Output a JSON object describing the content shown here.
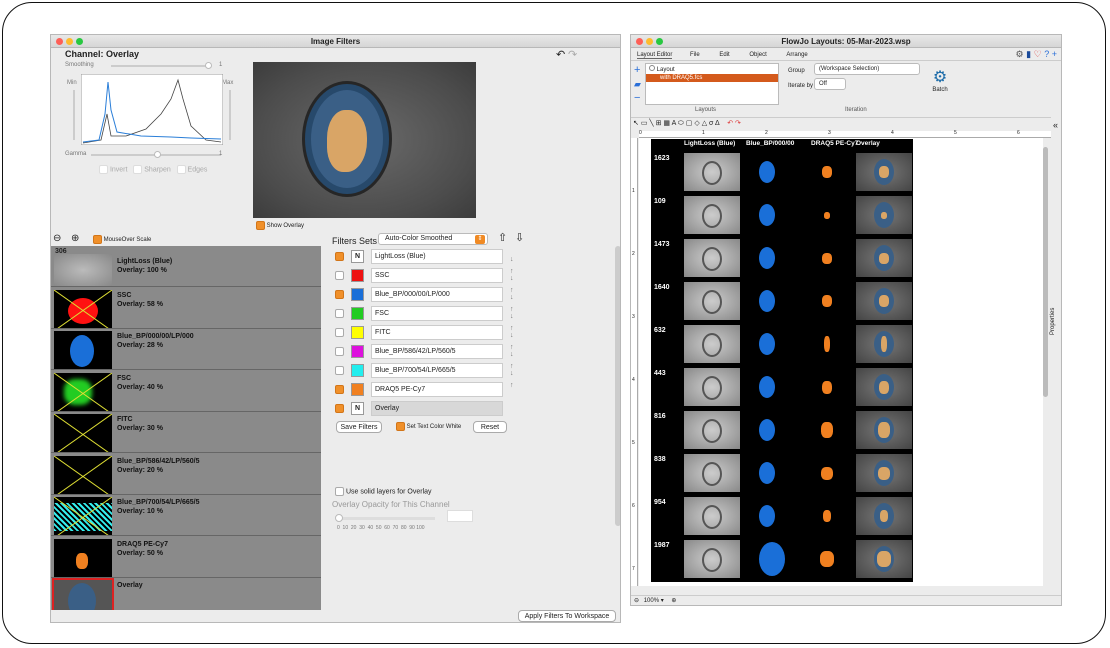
{
  "left_window": {
    "title": "Image Filters",
    "channel_title": "Channel: Overlay",
    "labels": {
      "smoothing": "Smoothing",
      "min": "Min",
      "max": "Max",
      "gamma": "Gamma",
      "one": "1",
      "invert": "Invert",
      "sharpen": "Sharpen",
      "edges": "Edges",
      "show_overlay": "Show Overlay",
      "mouseover_scale": "MouseOver Scale",
      "filters_sets": "Filters Sets",
      "filter_set_value": "Auto-Color Smoothed",
      "save_filters": "Save Filters",
      "set_text_color": "Set Text Color White",
      "reset": "Reset",
      "solid_layers": "Use solid layers for Overlay",
      "opacity_title": "Overlay Opacity for This Channel",
      "opacity_ticks": "0  10  20  30  40  50  60  70  80  90 100",
      "apply": "Apply Filters To Workspace"
    },
    "event_id": "306",
    "channels": [
      {
        "name": "LightLoss (Blue)",
        "overlay": "Overlay: 100 %",
        "kind": "gray",
        "crossed": false
      },
      {
        "name": "SSC",
        "overlay": "Overlay: 58 %",
        "kind": "red",
        "crossed": true
      },
      {
        "name": "Blue_BP/000/00/LP/000",
        "overlay": "Overlay: 28 %",
        "kind": "blue",
        "crossed": false
      },
      {
        "name": "FSC",
        "overlay": "Overlay: 40 %",
        "kind": "green",
        "crossed": true
      },
      {
        "name": "FITC",
        "overlay": "Overlay: 30 %",
        "kind": "black",
        "crossed": true
      },
      {
        "name": "Blue_BP/586/42/LP/560/5",
        "overlay": "Overlay: 20 %",
        "kind": "black",
        "crossed": true
      },
      {
        "name": "Blue_BP/700/54/LP/665/5",
        "overlay": "Overlay: 10 %",
        "kind": "cyan",
        "crossed": true
      },
      {
        "name": "DRAQ5 PE-Cy7",
        "overlay": "Overlay: 50 %",
        "kind": "orange",
        "crossed": false
      },
      {
        "name": "Overlay",
        "overlay": "",
        "kind": "overlay",
        "crossed": false
      }
    ],
    "filters": [
      {
        "name": "LightLoss (Blue)",
        "checked": true,
        "color": "#ffffff",
        "swatch": "N"
      },
      {
        "name": "SSC",
        "checked": false,
        "color": "#ee1111",
        "swatch": ""
      },
      {
        "name": "Blue_BP/000/00/LP/000",
        "checked": true,
        "color": "#1a6fd8",
        "swatch": ""
      },
      {
        "name": "FSC",
        "checked": false,
        "color": "#22cc22",
        "swatch": ""
      },
      {
        "name": "FITC",
        "checked": false,
        "color": "#ffff00",
        "swatch": ""
      },
      {
        "name": "Blue_BP/586/42/LP/560/5",
        "checked": false,
        "color": "#dd11dd",
        "swatch": ""
      },
      {
        "name": "Blue_BP/700/54/LP/665/5",
        "checked": false,
        "color": "#22eeee",
        "swatch": ""
      },
      {
        "name": "DRAQ5 PE-Cy7",
        "checked": true,
        "color": "#f08020",
        "swatch": ""
      },
      {
        "name": "Overlay",
        "checked": true,
        "color": "#ffffff",
        "swatch": "N"
      }
    ]
  },
  "right_window": {
    "title": "FlowJo Layouts: 05-Mar-2023.wsp",
    "menu": [
      "Layout Editor",
      "File",
      "Edit",
      "Object",
      "Arrange"
    ],
    "tree": {
      "root": "Layout",
      "child": "with DRAQ5.fcs"
    },
    "layouts_label": "Layouts",
    "group_label": "Group",
    "group_value": "(Workspace Selection)",
    "iterate_label": "Iterate by",
    "iterate_value": "Off",
    "iteration_label": "Iteration",
    "batch_label": "Batch",
    "properties": "Properties",
    "zoom": "100%",
    "ruler": [
      "0",
      "1",
      "2",
      "3",
      "4",
      "5",
      "6"
    ],
    "vruler": [
      "1",
      "2",
      "3",
      "4",
      "5",
      "6",
      "7"
    ],
    "headers": [
      "LightLoss (Blue)",
      "Blue_BP/000/00",
      "DRAQ5 PE-Cy7",
      "Overlay"
    ],
    "events": [
      "1623",
      "109",
      "1473",
      "1640",
      "632",
      "443",
      "816",
      "838",
      "954",
      "1987"
    ]
  }
}
